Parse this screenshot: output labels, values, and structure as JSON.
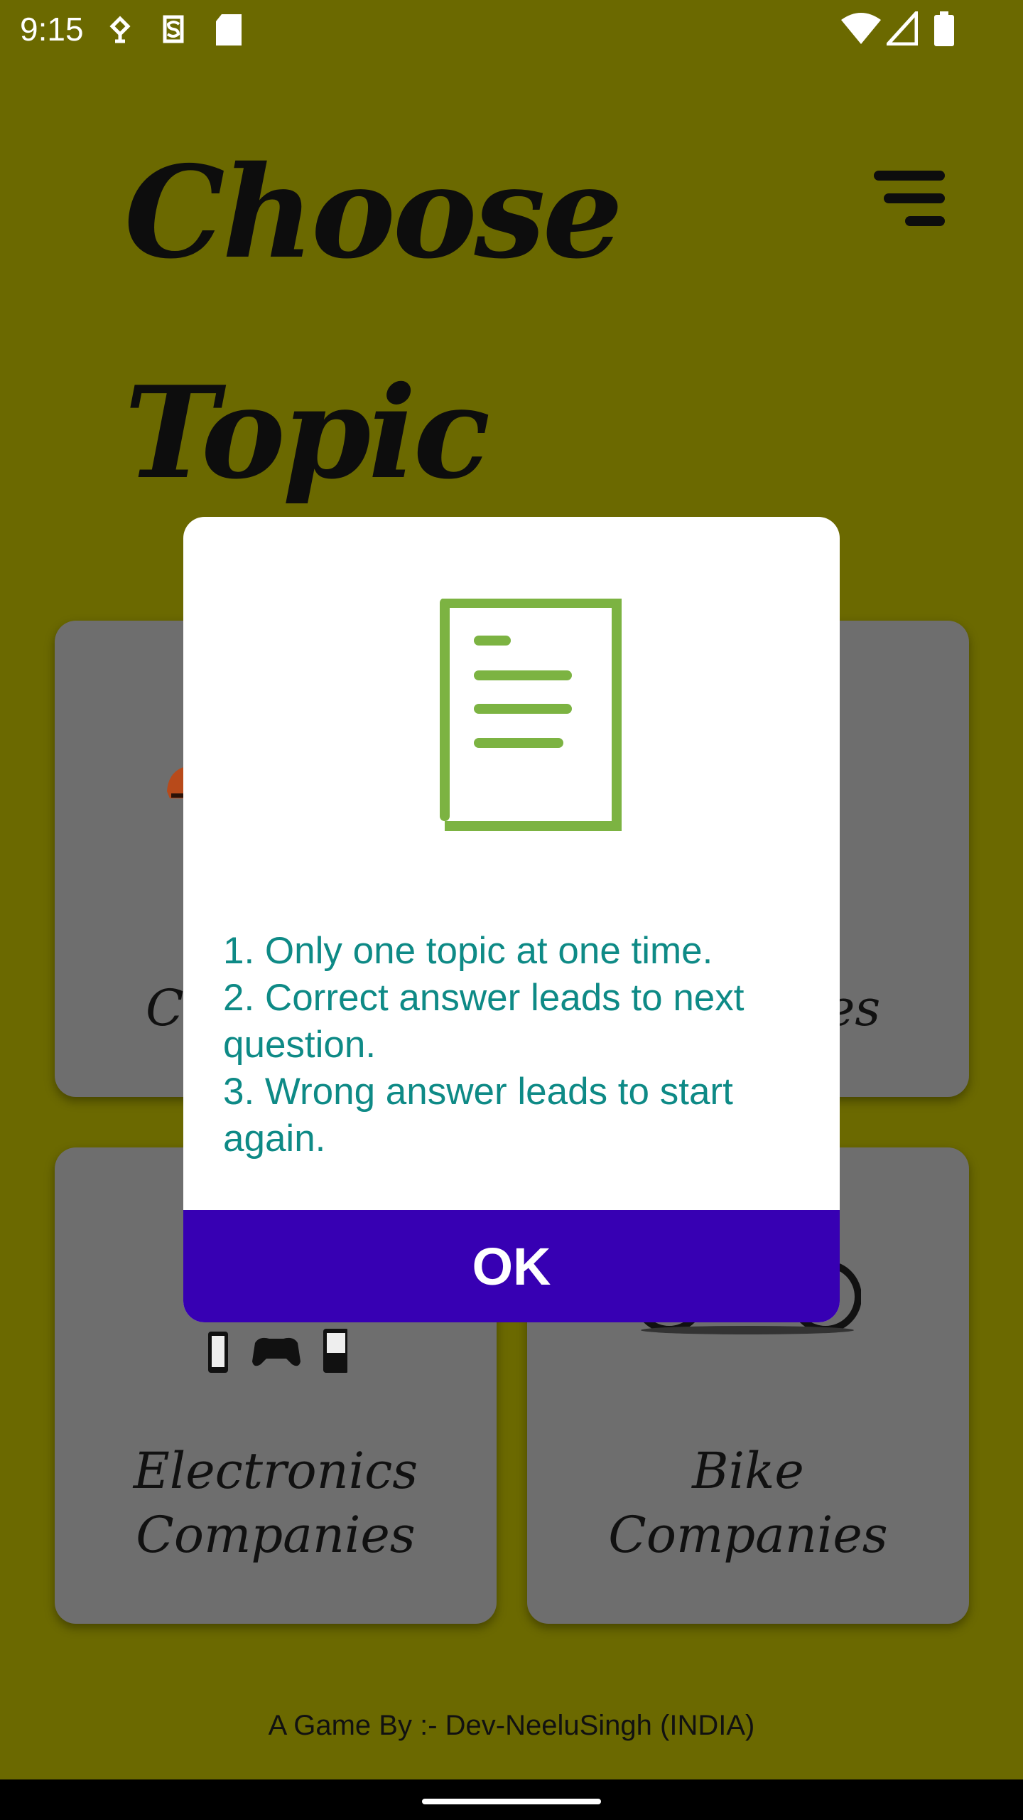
{
  "status_bar": {
    "time": "9:15",
    "icons": [
      "location-pin-icon",
      "shield-s-icon",
      "sd-card-icon",
      "wifi-icon",
      "signal-icon",
      "battery-icon"
    ]
  },
  "header": {
    "title_line1": "Choose",
    "title_line2": "Topic",
    "menu_icon": "sort-menu-icon"
  },
  "cards": [
    {
      "label_line1": "Ca",
      "label_line2": ""
    },
    {
      "label_line1": "es",
      "label_line2": ""
    },
    {
      "label_line1": "Electronics",
      "label_line2": "Companies"
    },
    {
      "label_line1": "Bike",
      "label_line2": "Companies"
    }
  ],
  "dialog": {
    "icon": "document-list-icon",
    "rules": [
      "1. Only one topic at one time.",
      "2. Correct answer leads to next question.",
      "3. Wrong answer leads to start again."
    ],
    "ok_label": "OK",
    "accent_color": "#7cb342",
    "text_color": "#0e8a86",
    "button_color": "#3700b3"
  },
  "footer": {
    "credit": "A Game By :- Dev-NeeluSingh (INDIA)"
  },
  "colors": {
    "background": "#6b6900",
    "card": "#6e6e6e"
  }
}
